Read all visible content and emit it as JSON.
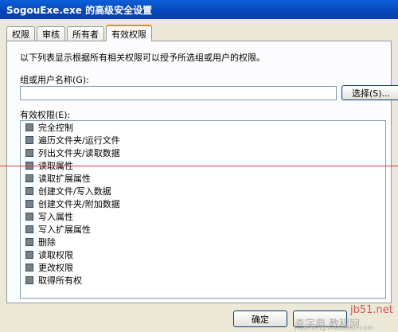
{
  "window": {
    "title": "SogouExe.exe 的高级安全设置"
  },
  "tabs": [
    {
      "label": "权限",
      "active": false
    },
    {
      "label": "审核",
      "active": false
    },
    {
      "label": "所有者",
      "active": false
    },
    {
      "label": "有效权限",
      "active": true
    }
  ],
  "panel": {
    "description": "以下列表显示根据所有相关权限可以授予所选组或用户的权限。",
    "group_label": "组或用户名称(G):",
    "group_value": "",
    "select_button": "选择(S)...",
    "permissions_label": "有效权限(E):",
    "permissions": [
      "完全控制",
      "遍历文件夹/运行文件",
      "列出文件夹/读取数据",
      "读取属性",
      "读取扩展属性",
      "创建文件/写入数据",
      "创建文件夹/附加数据",
      "写入属性",
      "写入扩展属性",
      "删除",
      "读取权限",
      "更改权限",
      "取得所有权"
    ]
  },
  "footer": {
    "ok_button": "确定"
  },
  "watermark": {
    "site": "jb51.net",
    "name": "查字典 教程网",
    "url": "jiaocheng.chazidian.com"
  }
}
